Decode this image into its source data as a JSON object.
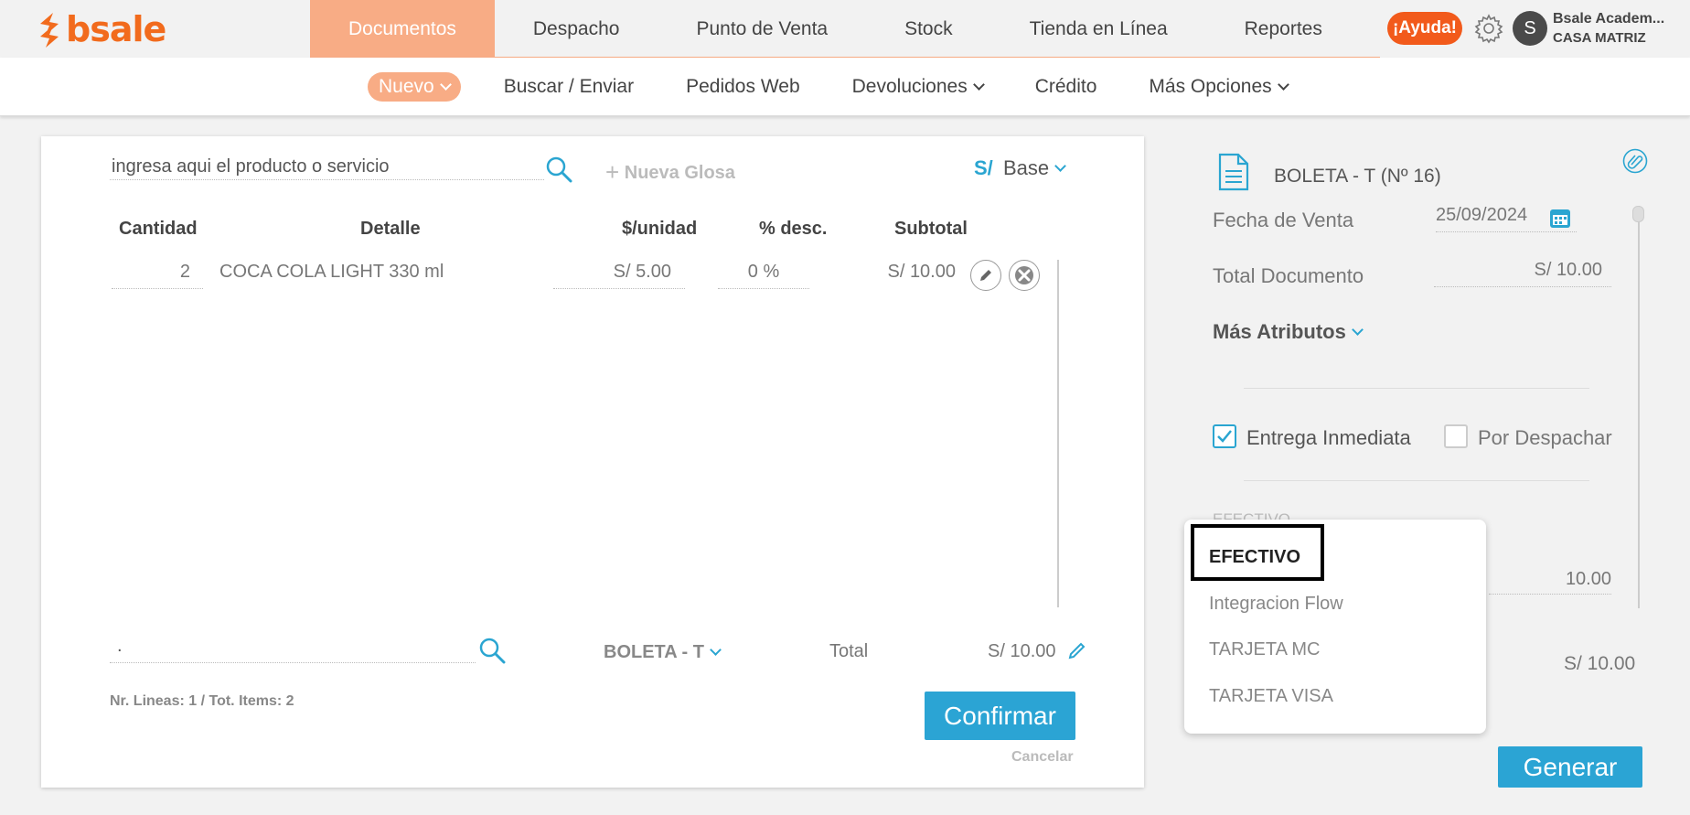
{
  "brand": {
    "logo_text": "bsale",
    "accent": "#f26b1d"
  },
  "main_nav": {
    "items": [
      {
        "label": "Documentos",
        "active": true
      },
      {
        "label": "Despacho"
      },
      {
        "label": "Punto de Venta"
      },
      {
        "label": "Stock"
      },
      {
        "label": "Tienda en Línea"
      },
      {
        "label": "Reportes"
      }
    ],
    "active_color": "#f8ac85"
  },
  "header": {
    "help_label": "¡Ayuda!",
    "settings_icon": "gear-icon",
    "user_initial": "S",
    "user_name": "Bsale Academ...",
    "user_branch": "CASA MATRIZ"
  },
  "sub_nav": {
    "items": [
      {
        "label": "Nuevo",
        "dropdown": true,
        "active": true
      },
      {
        "label": "Buscar / Enviar"
      },
      {
        "label": "Pedidos Web"
      },
      {
        "label": "Devoluciones",
        "dropdown": true
      },
      {
        "label": "Crédito"
      },
      {
        "label": "Más Opciones",
        "dropdown": true
      }
    ]
  },
  "document_editor": {
    "product_search_value": "ingresa aqui el producto o servicio",
    "new_gloss_label": "Nueva Glosa",
    "currency_symbol": "S/",
    "price_list": "Base",
    "columns": [
      "Cantidad",
      "Detalle",
      "$/unidad",
      "% desc.",
      "Subtotal"
    ],
    "rows": [
      {
        "quantity": "2",
        "detail": "COCA COLA LIGHT 330 ml",
        "unit_price": "S/ 5.00",
        "discount": "0 %",
        "subtotal": "S/ 10.00"
      }
    ],
    "client_input_value": ".",
    "document_type": "BOLETA - T",
    "total_label": "Total",
    "total_value": "S/ 10.00",
    "lines_info": "Nr. Lineas: 1 / Tot. Items: 2",
    "confirm_label": "Confirmar",
    "cancel_label": "Cancelar"
  },
  "document_panel": {
    "title": "BOLETA - T (Nº 16)",
    "sale_date_label": "Fecha de Venta",
    "sale_date_value": "25/09/2024",
    "doc_total_label": "Total Documento",
    "doc_total_value": "S/ 10.00",
    "more_attributes_label": "Más Atributos",
    "immediate_delivery_label": "Entrega Inmediata",
    "immediate_delivery_checked": true,
    "to_dispatch_label": "Por Despachar",
    "to_dispatch_checked": false,
    "payment_section_label": "EFECTIVO",
    "payment_amount": "10.00",
    "payment_total": "S/ 10.00",
    "generate_label": "Generar"
  },
  "payment_dropdown": {
    "options": [
      "EFECTIVO",
      "Integracion Flow",
      "TARJETA MC",
      "TARJETA VISA"
    ],
    "selected": "EFECTIVO"
  }
}
